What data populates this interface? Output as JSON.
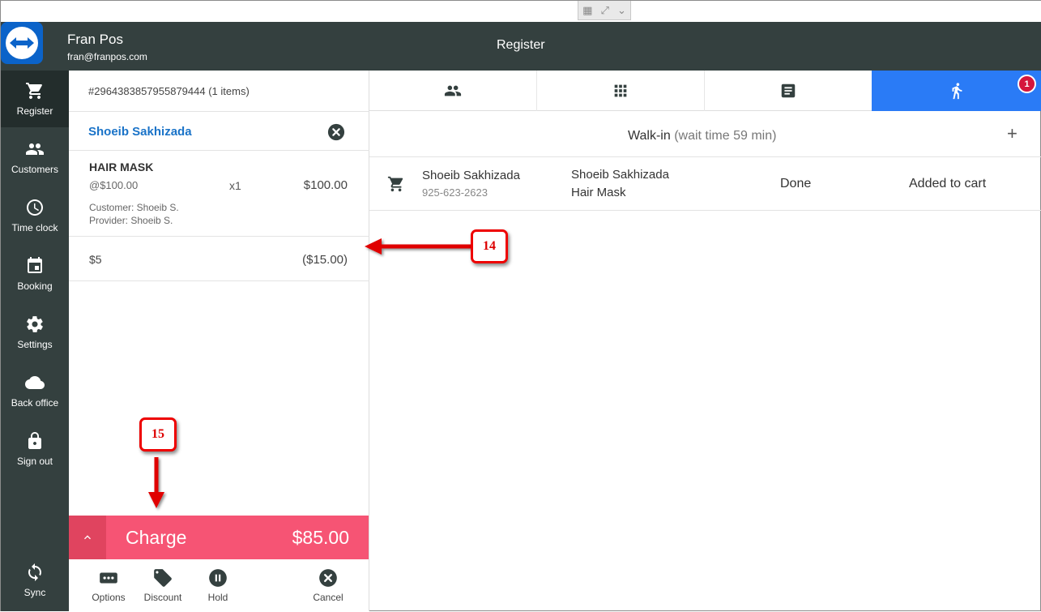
{
  "remote_toolbar": {
    "icons": [
      "grid-icon",
      "fullscreen-icon",
      "chevron-down-icon"
    ]
  },
  "header": {
    "user_name": "Fran Pos",
    "user_email": "fran@franpos.com",
    "title": "Register"
  },
  "sidebar": {
    "items": [
      {
        "label": "Register",
        "icon": "cart-icon",
        "active": true
      },
      {
        "label": "Customers",
        "icon": "people-icon"
      },
      {
        "label": "Time clock",
        "icon": "clock-icon"
      },
      {
        "label": "Booking",
        "icon": "calendar-icon"
      },
      {
        "label": "Settings",
        "icon": "gear-icon"
      },
      {
        "label": "Back office",
        "icon": "cloud-icon"
      },
      {
        "label": "Sign out",
        "icon": "lock-icon"
      }
    ],
    "sync_label": "Sync"
  },
  "cart": {
    "order_id": "#2964383857955879444 (1 items)",
    "customer_name": "Shoeib Sakhizada",
    "item": {
      "name": "HAIR MASK",
      "unit_price": "@$100.00",
      "quantity": "x1",
      "total": "$100.00",
      "customer": "Customer: Shoeib S.",
      "provider": "Provider: Shoeib S."
    },
    "discount": {
      "label": "$5",
      "amount": "($15.00)"
    },
    "charge": {
      "label": "Charge",
      "amount": "$85.00"
    },
    "actions": [
      {
        "label": "Options",
        "icon": "more-icon"
      },
      {
        "label": "Discount",
        "icon": "tag-icon"
      },
      {
        "label": "Hold",
        "icon": "pause-icon"
      },
      {
        "label": "Cancel",
        "icon": "cancel-icon"
      }
    ]
  },
  "tabs": {
    "items": [
      {
        "icon": "people-icon"
      },
      {
        "icon": "grid-icon"
      },
      {
        "icon": "list-icon"
      },
      {
        "icon": "walk-icon",
        "active": true
      }
    ],
    "badge": "1"
  },
  "walkin": {
    "title": "Walk-in",
    "wait": "(wait time 59 min)",
    "add": "+",
    "row": {
      "customer_name": "Shoeib Sakhizada",
      "phone": "925-623-2623",
      "provider": "Shoeib Sakhizada",
      "service": "Hair Mask",
      "status": "Done",
      "action": "Added to cart"
    }
  },
  "annotations": [
    {
      "number": "14"
    },
    {
      "number": "15"
    }
  ],
  "colors": {
    "appbar": "#34403f",
    "accent_blue": "#2a7bf6",
    "charge": "#f65474",
    "badge": "#d5163c",
    "callout_red": "#e00000",
    "link_blue": "#1a73c8"
  }
}
